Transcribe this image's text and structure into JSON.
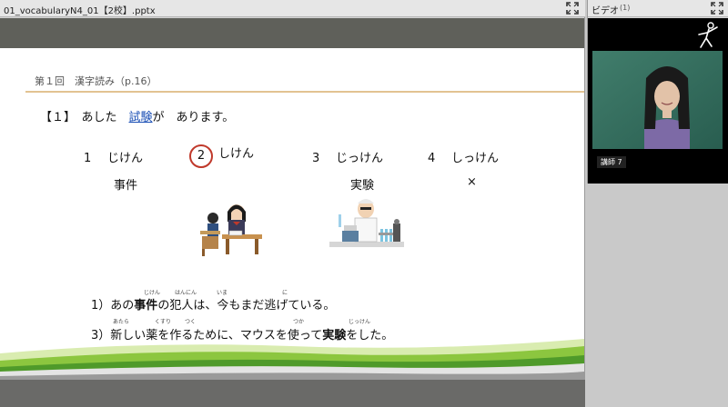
{
  "presentation": {
    "window_title": "01_vocabularyN4_01【2校】.pptx",
    "slide": {
      "subtitle": "第１回　漢字読み（p.16）",
      "question": {
        "prefix": "【１】　あした　",
        "keyword": "試験",
        "suffix": "が　あります。"
      },
      "choices": [
        {
          "num": "1",
          "text": "じけん",
          "kanji": "事件"
        },
        {
          "num": "2",
          "text": "しけん",
          "kanji": "",
          "circled": true
        },
        {
          "num": "3",
          "text": "じっけん",
          "kanji": "実験"
        },
        {
          "num": "4",
          "text": "しっけん",
          "kanji": "×"
        }
      ],
      "sentence1": {
        "num": "1）",
        "p1": "あの",
        "b1": "事件",
        "p2": "の犯人は、今もまだ逃げている。"
      },
      "sentence2": {
        "num": "3）",
        "p1": "新しい薬を作るために、マウスを使って",
        "b1": "実験",
        "p2": "をした。"
      },
      "ruby1": [
        "じけん",
        "はんにん",
        "いま",
        "に"
      ],
      "ruby2": [
        "あたら",
        "くすり",
        "つく",
        "つか",
        "じっけん"
      ]
    }
  },
  "video": {
    "title": "ビデオ",
    "count": "(1)",
    "participant_name": "講師 7"
  },
  "icons": {
    "expand": "expand-icon",
    "app_logo": "figure-logo-icon"
  }
}
